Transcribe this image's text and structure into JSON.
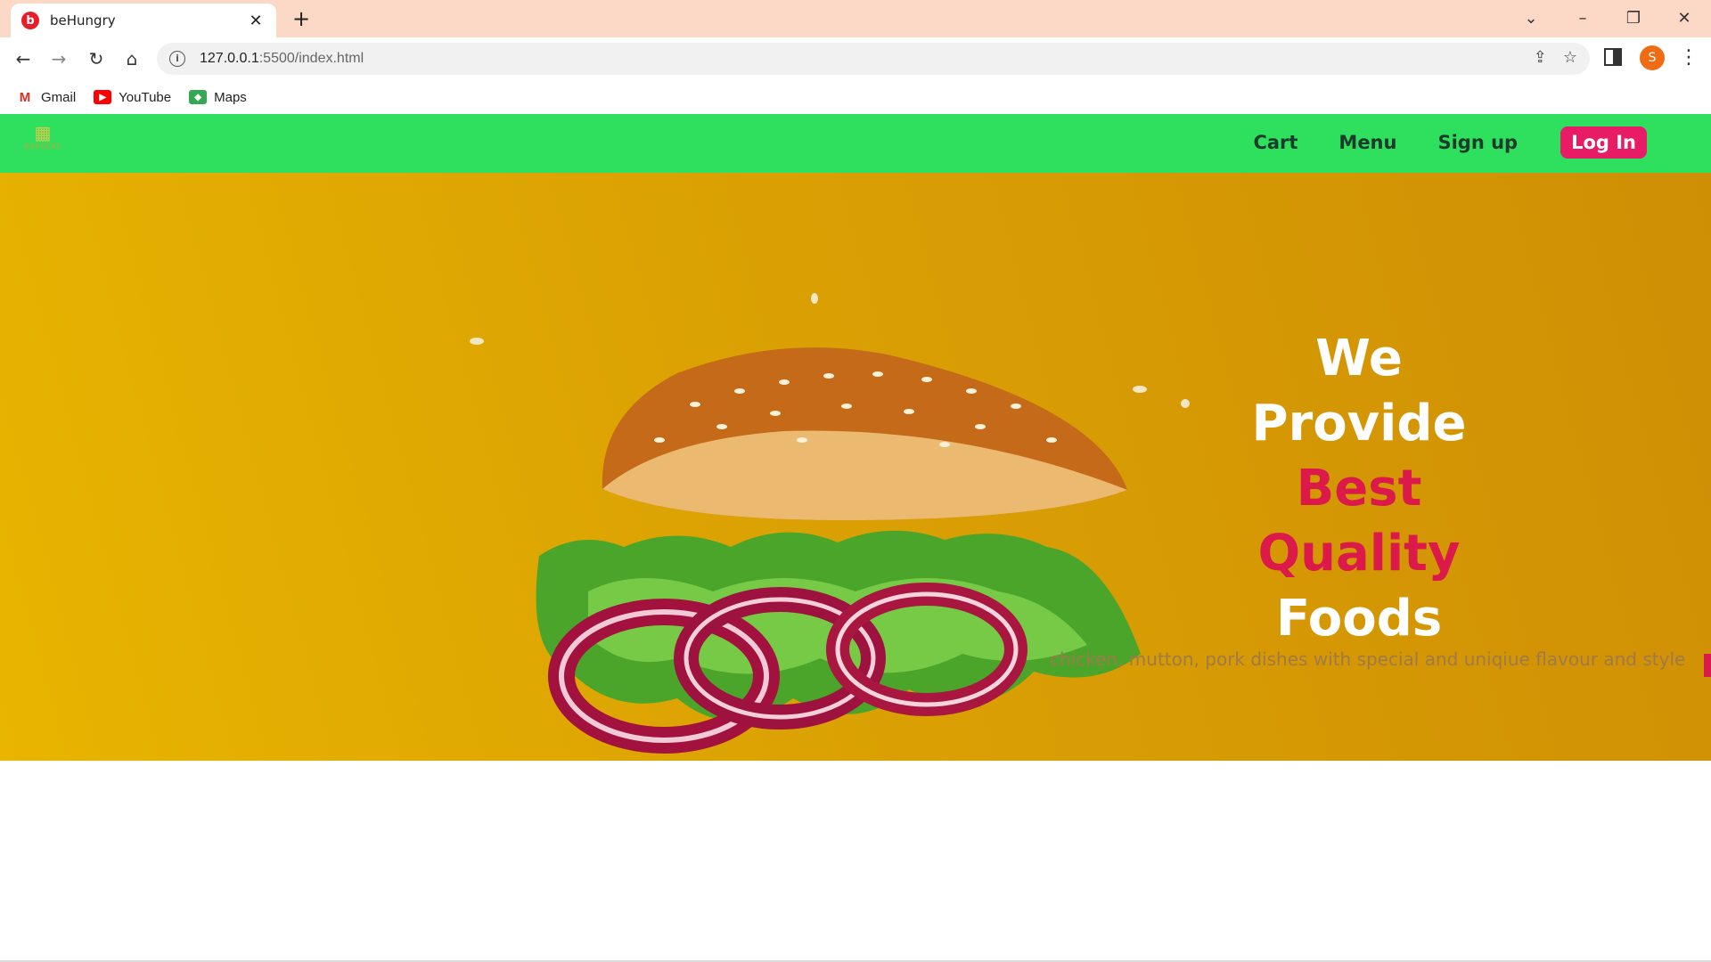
{
  "browser": {
    "tab_title": "beHungry",
    "tab_favicon_letter": "b",
    "url_host": "127.0.0.1",
    "url_path": ":5500/index.html",
    "profile_initial": "S",
    "bookmarks": [
      {
        "label": "Gmail",
        "icon": "gmail-icon"
      },
      {
        "label": "YouTube",
        "icon": "youtube-icon"
      },
      {
        "label": "Maps",
        "icon": "maps-icon"
      }
    ]
  },
  "site": {
    "logo_text": "BURGERS",
    "nav": {
      "cart": "Cart",
      "menu": "Menu",
      "signup": "Sign up",
      "login": "Log In"
    },
    "hero": {
      "line1": "We",
      "line2": "Provide",
      "line3": "Best",
      "line4": "Quality",
      "line5": "Foods",
      "subtitle": "chicken, mutton, pork dishes with special and uniqiue flavour and style"
    },
    "colors": {
      "nav_bg": "#2fe05f",
      "accent": "#e81c66",
      "hero_bg": "#dca303"
    }
  }
}
